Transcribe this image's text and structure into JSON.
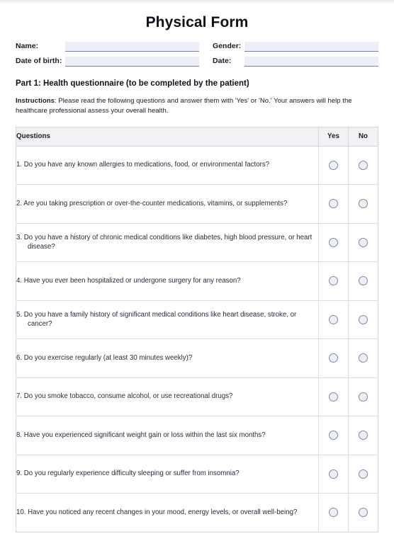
{
  "document": {
    "title": "Physical Form"
  },
  "identity": {
    "fields": [
      {
        "label": "Name:",
        "value": "",
        "placeholder": "",
        "name": "name"
      },
      {
        "label": "Gender:",
        "value": "",
        "placeholder": "",
        "name": "gender"
      },
      {
        "label": "Date of birth:",
        "value": "",
        "placeholder": "",
        "name": "date-of-birth"
      },
      {
        "label": "Date:",
        "value": "",
        "placeholder": "",
        "name": "date"
      }
    ]
  },
  "part1": {
    "heading": "Part 1: Health questionnaire (to be completed by the patient)",
    "instructions_label": "Instructions",
    "instructions_text": ": Please read the following questions and answer them with 'Yes' or 'No.' Your answers will help the healthcare professional assess your overall health."
  },
  "table": {
    "headers": {
      "questions": "Questions",
      "yes": "Yes",
      "no": "No"
    },
    "rows": [
      {
        "num": "1.",
        "text": "Do you have any known allergies to medications, food, or environmental factors?"
      },
      {
        "num": "2.",
        "text": "Are you taking prescription or over-the-counter medications, vitamins, or supplements?"
      },
      {
        "num": "3.",
        "text": "Do you have a history of chronic medical conditions like diabetes, high blood pressure, or heart disease?"
      },
      {
        "num": "4.",
        "text": "Have you ever been hospitalized or undergone surgery for any reason?"
      },
      {
        "num": "5.",
        "text": "Do you have a family history of significant medical conditions like heart disease, stroke, or cancer?"
      },
      {
        "num": "6.",
        "text": "Do you exercise regularly (at least 30 minutes weekly)?"
      },
      {
        "num": "7.",
        "text": "Do you smoke tobacco, consume alcohol, or use recreational drugs?"
      },
      {
        "num": "8.",
        "text": "Have you experienced significant weight gain or loss within the last six months?"
      },
      {
        "num": "9.",
        "text": "Do you regularly experience difficulty sleeping or suffer from insomnia?"
      },
      {
        "num": "10.",
        "text": "Have you noticed any recent changes in your mood, energy levels, or overall well-being?"
      }
    ]
  },
  "colors": {
    "field_fill": "#eceefa",
    "field_underline": "#7d8096",
    "table_border": "#d3d4dd",
    "header_bg": "#f2f2f4",
    "text": "#1b1b26",
    "question_text": "#2a2a3a",
    "radio_fill": "#eceefa",
    "radio_border": "#85879c"
  }
}
